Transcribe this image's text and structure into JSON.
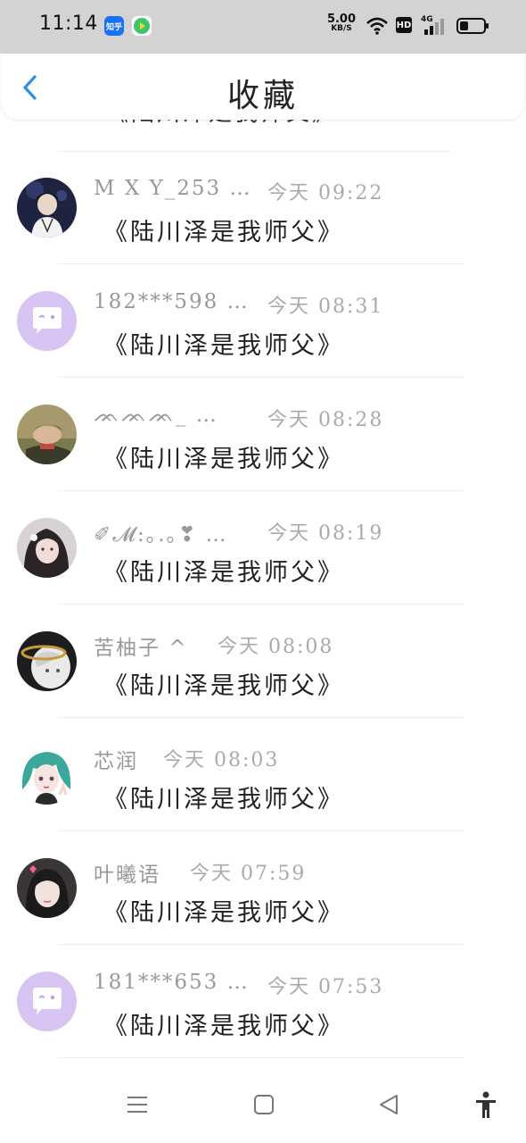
{
  "status_bar": {
    "time": "11:14",
    "app_badge_zhihu": "知乎",
    "net_speed_value": "5.00",
    "net_speed_unit": "KB/S",
    "hd_label": "HD",
    "signal_label": "4G"
  },
  "header": {
    "title": "收藏"
  },
  "partial_item": {
    "message": "《陆川泽是我师父》"
  },
  "items": [
    {
      "name": "M X Y_253 …",
      "time": "今天 09:22",
      "message": "《陆川泽是我师父》",
      "avatar": "photo-concert"
    },
    {
      "name": "182***598 …",
      "time": "今天 08:31",
      "message": "《陆川泽是我师父》",
      "avatar": "default-chat"
    },
    {
      "name": "ᨏᨏᨏ_ …",
      "time": "今天 08:28",
      "message": "《陆川泽是我师父》",
      "avatar": "photo-sleeping"
    },
    {
      "name": "✐𝓜:｡.｡❣ …",
      "time": "今天 08:19",
      "message": "《陆川泽是我师父》",
      "avatar": "photo-girl"
    },
    {
      "name": "苦柚子 ^",
      "time": "今天 08:08",
      "message": "《陆川泽是我师父》",
      "avatar": "anime-halo"
    },
    {
      "name": "芯润",
      "time": "今天 08:03",
      "message": "《陆川泽是我师父》",
      "avatar": "anime-green-hair"
    },
    {
      "name": "叶曦语",
      "time": "今天 07:59",
      "message": "《陆川泽是我师父》",
      "avatar": "photo-girl-heart"
    },
    {
      "name": "181***653 …",
      "time": "今天 07:53",
      "message": "《陆川泽是我师父》",
      "avatar": "default-chat"
    }
  ],
  "nav": {
    "buttons": [
      "menu-icon",
      "home-square-icon",
      "back-triangle-icon",
      "accessibility-icon"
    ]
  },
  "colors": {
    "status_bar_bg": "#d3d3d3",
    "back_arrow": "#2f8fe6",
    "default_avatar_bg": "#d8c4f3",
    "name_text": "#999999",
    "time_text": "#aaaaaa"
  }
}
